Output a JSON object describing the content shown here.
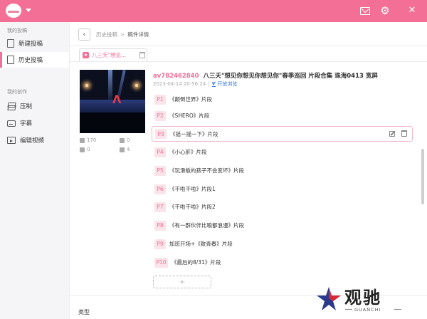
{
  "titlebar": {
    "icons": [
      "app-logo",
      "mail-icon",
      "gear-icon",
      "close-icon"
    ]
  },
  "sidebar": {
    "section1": "我的投稿",
    "items1": [
      {
        "label": "新建投稿",
        "icon": "document-icon",
        "active": false
      },
      {
        "label": "历史投稿",
        "icon": "history-document-icon",
        "active": true
      }
    ],
    "section2": "我的创作",
    "items2": [
      {
        "label": "压制",
        "icon": "layers-icon"
      },
      {
        "label": "字幕",
        "icon": "subtitle-icon"
      },
      {
        "label": "编辑视频",
        "icon": "edit-video-icon"
      }
    ]
  },
  "breadcrumb": {
    "back": "‹",
    "parent": "历史投稿",
    "sep": ">",
    "current": "稿件详情"
  },
  "file_tab": {
    "label": "八三夭\"想见..."
  },
  "video": {
    "av": "av782462840",
    "title": "八三夭\"想见你想见你想见你\"春季巡回 片段合集 珠海0413 宽屏",
    "datetime": "2023-04-14 20:56:24",
    "visibility": "开放浏览",
    "stats": {
      "plays": "170",
      "danmaku": "0",
      "coins": "0",
      "favorites": "4"
    }
  },
  "parts": [
    {
      "badge": "P1",
      "name": "《颠倒世界》片段"
    },
    {
      "badge": "P2",
      "name": "《SHERO》片段"
    },
    {
      "badge": "P3",
      "name": "《摇一摇一下》片段"
    },
    {
      "badge": "P4",
      "name": "《小心肝》片段"
    },
    {
      "badge": "P5",
      "name": "《玩滑板的孩子不会变坏》片段"
    },
    {
      "badge": "P6",
      "name": "《干啦干啦》片段1"
    },
    {
      "badge": "P7",
      "name": "《干啦干啦》片段2"
    },
    {
      "badge": "P8",
      "name": "《有一群伙伴比喻都浪漫》片段"
    },
    {
      "badge": "P9",
      "name": "加班开场+《致青春》片段"
    },
    {
      "badge": "P10",
      "name": "《最后的8/31》片段"
    }
  ],
  "add_part": "+",
  "type_label": "类型",
  "watermark": {
    "text": "观驰",
    "sub": "GUANCHI"
  },
  "colors": {
    "accent": "#f46f95",
    "link": "#3a7bd5"
  }
}
